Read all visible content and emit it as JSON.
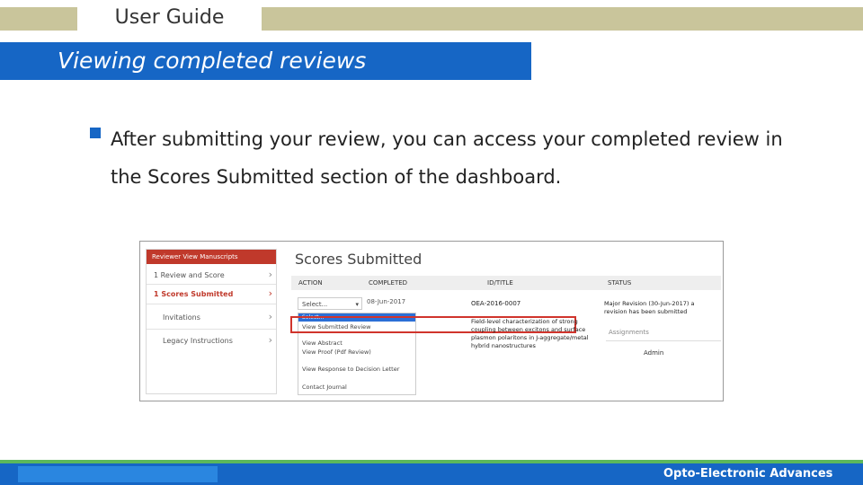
{
  "header": {
    "title": "User Guide"
  },
  "banner": {
    "title": "Viewing completed reviews"
  },
  "bullet": {
    "text": "After submitting your review, you can access your completed review in the Scores Submitted section of the dashboard."
  },
  "screenshot": {
    "sidebar": {
      "heading": "Reviewer View Manuscripts",
      "items": [
        {
          "label": "1   Review and Score",
          "active": false
        },
        {
          "label": "1   Scores Submitted",
          "active": true
        },
        {
          "label": "Invitations",
          "active": false
        },
        {
          "label": "Legacy Instructions",
          "active": false
        }
      ]
    },
    "title": "Scores Submitted",
    "columns": [
      "ACTION",
      "COMPLETED",
      "ID/TITLE",
      "STATUS"
    ],
    "row": {
      "select_label": "Select...",
      "completed": "08-Jun-2017",
      "id": "OEA-2016-0007",
      "title": "Field-level characterization of strong coupling between excitons and surface plasmon polaritons in J-aggregate/metal hybrid nanostructures",
      "status": "Major Revision (30-Jun-2017) a revision has been submitted",
      "assignments_label": "Assignments",
      "admin": "Admin"
    },
    "dropdown_options": [
      "Select...",
      "View Submitted Review",
      "View Abstract",
      "View Proof (Pdf Review)",
      "View Response to Decision Letter",
      "Contact Journal"
    ]
  },
  "footer": {
    "text": "Opto-Electronic Advances"
  },
  "colors": {
    "brand_blue": "#1666c5",
    "header_tan": "#c9c59b",
    "footer_green": "#5cb85c",
    "highlight_red": "#d0342c"
  }
}
